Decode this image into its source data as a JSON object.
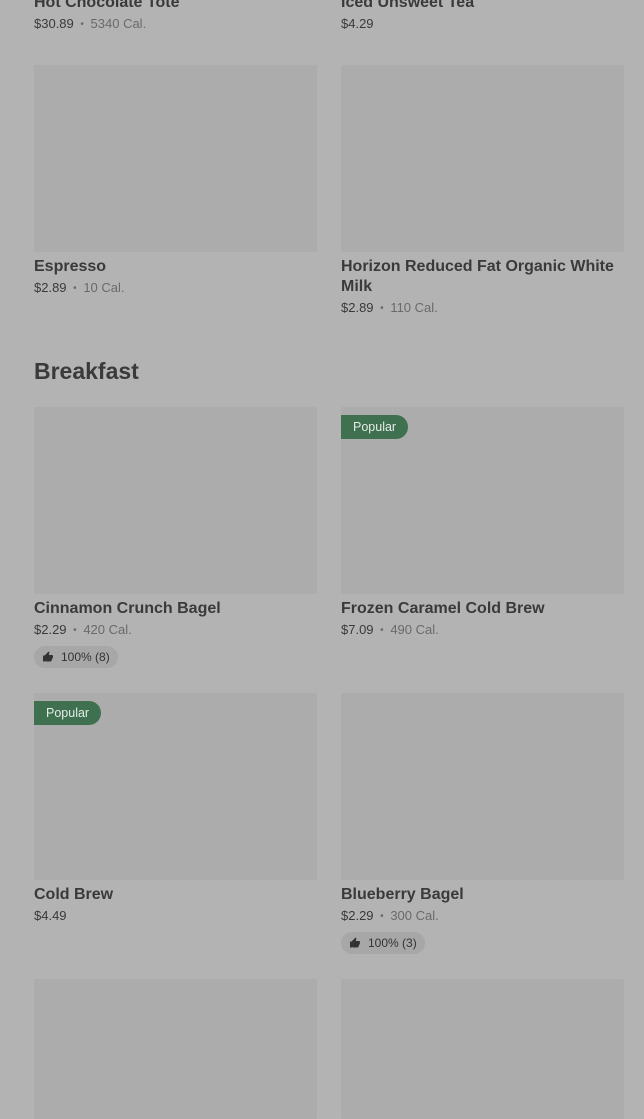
{
  "section": {
    "title": "Breakfast"
  },
  "items": [
    {
      "name": "Hot Chocolate Tote",
      "price": "$30.89",
      "calories": "5340 Cal."
    },
    {
      "name": "Iced Unsweet Tea",
      "price": "$4.29"
    },
    {
      "name": "Espresso",
      "price": "$2.89",
      "calories": "10 Cal."
    },
    {
      "name": "Horizon Reduced Fat Organic White Milk",
      "price": "$2.89",
      "calories": "110 Cal."
    },
    {
      "name": "Cinnamon Crunch Bagel",
      "price": "$2.29",
      "calories": "420 Cal.",
      "rating": "100% (8)"
    },
    {
      "name": "Frozen Caramel Cold Brew",
      "price": "$7.09",
      "calories": "490 Cal.",
      "badge": "Popular"
    },
    {
      "name": "Cold Brew",
      "price": "$4.49",
      "badge": "Popular"
    },
    {
      "name": "Blueberry Bagel",
      "price": "$2.29",
      "calories": "300 Cal.",
      "rating": "100% (3)"
    }
  ],
  "separator": "•",
  "icons": {
    "rating": "thumbs-up-icon"
  },
  "colors": {
    "badge": "#3f7050",
    "overlay": "#b3b3b3"
  }
}
